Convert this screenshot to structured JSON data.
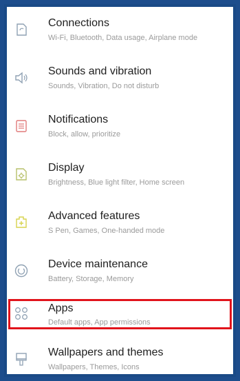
{
  "settings": {
    "items": [
      {
        "title": "Connections",
        "subtitle": "Wi-Fi, Bluetooth, Data usage, Airplane mode",
        "icon": "connections-icon",
        "color": "#8fa1b3"
      },
      {
        "title": "Sounds and vibration",
        "subtitle": "Sounds, Vibration, Do not disturb",
        "icon": "sound-icon",
        "color": "#8fa1b3"
      },
      {
        "title": "Notifications",
        "subtitle": "Block, allow, prioritize",
        "icon": "notifications-icon",
        "color": "#e07a7a"
      },
      {
        "title": "Display",
        "subtitle": "Brightness, Blue light filter, Home screen",
        "icon": "display-icon",
        "color": "#b7c06a"
      },
      {
        "title": "Advanced features",
        "subtitle": "S Pen, Games, One-handed mode",
        "icon": "advanced-features-icon",
        "color": "#d7d34e"
      },
      {
        "title": "Device maintenance",
        "subtitle": "Battery, Storage, Memory",
        "icon": "device-maintenance-icon",
        "color": "#8fa1b3"
      },
      {
        "title": "Apps",
        "subtitle": "Default apps, App permissions",
        "icon": "apps-icon",
        "color": "#8fa1b3"
      },
      {
        "title": "Wallpapers and themes",
        "subtitle": "Wallpapers, Themes, Icons",
        "icon": "wallpapers-icon",
        "color": "#8fa1b3"
      }
    ],
    "highlighted_item": "Apps",
    "highlight_color": "#e1131b"
  }
}
